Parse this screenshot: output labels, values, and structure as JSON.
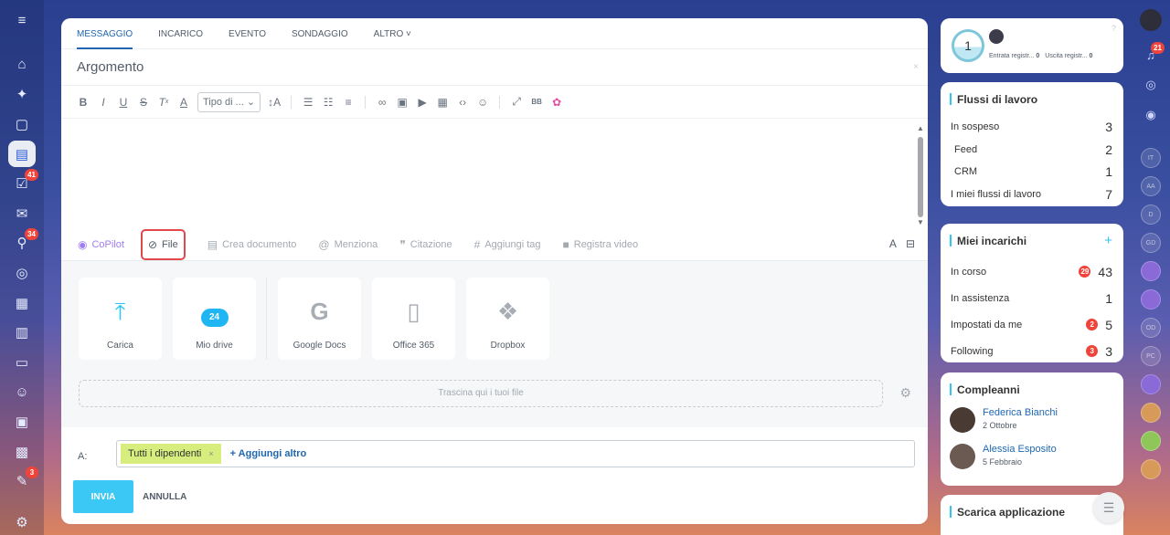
{
  "left_rail": {
    "items": [
      {
        "name": "menu-icon",
        "glyph": "≡"
      },
      {
        "name": "home-icon",
        "glyph": "⌂"
      },
      {
        "name": "copilot-icon",
        "glyph": "✦"
      },
      {
        "name": "chat-icon",
        "glyph": "▢"
      },
      {
        "name": "feed-icon",
        "glyph": "▤",
        "active": true
      },
      {
        "name": "tasks-icon",
        "glyph": "☑",
        "badge": "41"
      },
      {
        "name": "mail-icon",
        "glyph": "✉"
      },
      {
        "name": "filter-icon",
        "glyph": "⚲",
        "badge": "34"
      },
      {
        "name": "target-icon",
        "glyph": "◎"
      },
      {
        "name": "calendar-icon",
        "glyph": "▦"
      },
      {
        "name": "document-icon",
        "glyph": "▥"
      },
      {
        "name": "drive-icon",
        "glyph": "▭"
      },
      {
        "name": "users-icon",
        "glyph": "☺"
      },
      {
        "name": "board-icon",
        "glyph": "▣"
      },
      {
        "name": "schedule-icon",
        "glyph": "▩"
      },
      {
        "name": "edit-icon",
        "glyph": "✎",
        "badge": "3"
      },
      {
        "name": "settings-icon",
        "glyph": "⚙"
      }
    ]
  },
  "composer": {
    "tabs": [
      "MESSAGGIO",
      "INCARICO",
      "EVENTO",
      "SONDAGGIO",
      "ALTRO ˅"
    ],
    "active_tab": 0,
    "subject_placeholder": "Argomento",
    "subject_close": "×",
    "toolbar": {
      "font_select": "Tipo di ...",
      "font_select_arrow": "⌄"
    },
    "actions": {
      "copilot": "CoPilot",
      "file": "File",
      "create_doc": "Crea documento",
      "mention": "Menziona",
      "quote": "Citazione",
      "add_tag": "Aggiungi tag",
      "record_video": "Registra video"
    },
    "tiles": {
      "upload": "Carica",
      "my_drive": "Mio drive",
      "drive_badge": "24",
      "google_docs": "Google Docs",
      "office365": "Office 365",
      "dropbox": "Dropbox"
    },
    "dropzone": "Trascina qui i tuoi file",
    "to_label": "A:",
    "recipient_chip": "Tutti i dipendenti",
    "add_more": "+ Aggiungi altro",
    "send": "INVIA",
    "cancel": "ANNULLA"
  },
  "timeman": {
    "count": "1",
    "clock_in_label": "Entrata registr...",
    "clock_in_value": "0",
    "clock_out_label": "Uscita registr...",
    "clock_out_value": "0"
  },
  "workflows": {
    "title": "Flussi di lavoro",
    "pending_label": "In sospeso",
    "pending_value": "3",
    "feed_label": "Feed",
    "feed_value": "2",
    "crm_label": "CRM",
    "crm_value": "1",
    "mine_label": "I miei flussi di lavoro",
    "mine_value": "7"
  },
  "tasks": {
    "title": "Miei incarichi",
    "plus": "+",
    "in_progress_label": "In corso",
    "in_progress_badge": "29",
    "in_progress_value": "43",
    "assisting_label": "In assistenza",
    "assisting_value": "1",
    "set_by_me_label": "Impostati da me",
    "set_by_me_badge": "2",
    "set_by_me_value": "5",
    "following_label": "Following",
    "following_badge": "3",
    "following_value": "3"
  },
  "birthdays": {
    "title": "Compleanni",
    "people": [
      {
        "name": "Federica Bianchi",
        "date": "2 Ottobre"
      },
      {
        "name": "Alessia Esposito",
        "date": "5 Febbraio"
      }
    ]
  },
  "apps": {
    "title": "Scarica applicazione"
  },
  "right_rail": {
    "notification_badge": "21",
    "chats": [
      "IT",
      "AA",
      "D",
      "GD",
      "",
      "",
      "OD",
      "PC",
      "",
      "",
      "",
      ""
    ]
  },
  "colors": {
    "accent": "#2fc6f6",
    "link": "#2067b0",
    "send_button": "#3bc8f5",
    "highlight_border": "#e0484b",
    "chip": "#d7ee7e"
  }
}
